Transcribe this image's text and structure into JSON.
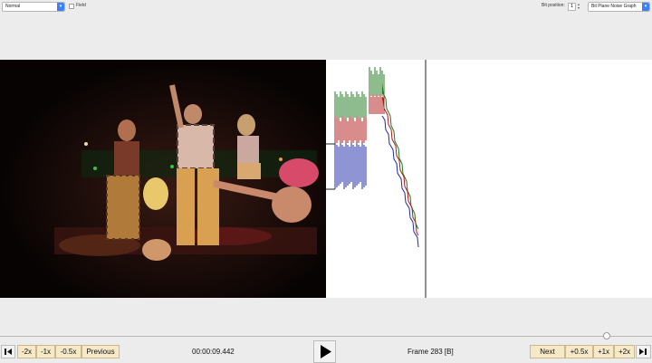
{
  "toolbar": {
    "mode_select": "Normal",
    "field_label": "Field",
    "bit_position_label": "Bit position:",
    "bit_position_value": "1",
    "graph_select": "Bit Plane Noise Graph"
  },
  "playback": {
    "timecode": "00:00:09.442",
    "frame_label": "Frame 283 [B]",
    "progress": 0.93,
    "buttons": {
      "minus_2x": "-2x",
      "minus_1x": "-1x",
      "minus_half": "-0.5x",
      "previous": "Previous",
      "next": "Next",
      "plus_half": "+0.5x",
      "plus_1x": "+1x",
      "plus_2x": "+2x"
    }
  },
  "colors": {
    "accent": "#3d7ff5",
    "button_bg": "#f5e9c8",
    "graph_red": "#b01818",
    "graph_green": "#1f7a1f",
    "graph_blue": "#1c2aa8"
  },
  "icons": [
    "chevron-down-icon",
    "step-back-icon",
    "play-icon",
    "step-forward-icon"
  ]
}
